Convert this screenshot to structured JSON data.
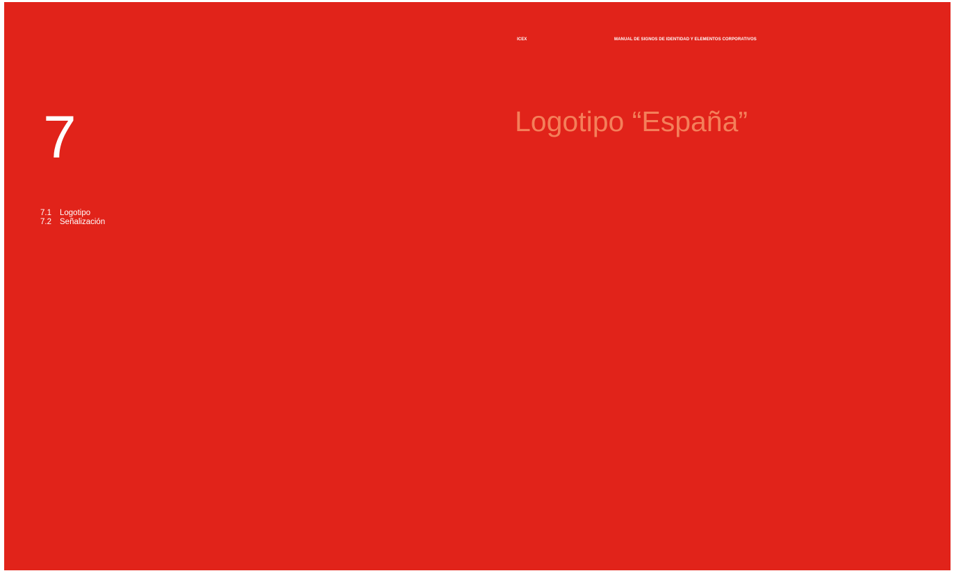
{
  "colors": {
    "page_background": "#e1231a",
    "text_primary": "#ffffff",
    "section_title": "#f47f5a"
  },
  "header": {
    "code": "ICEX",
    "title": "MANUAL DE SIGNOS DE IDENTIDAD Y ELEMENTOS CORPORATIVOS"
  },
  "chapter": {
    "number": "7",
    "toc": [
      {
        "num": "7.1",
        "label": "Logotipo"
      },
      {
        "num": "7.2",
        "label": "Señalización"
      }
    ]
  },
  "section": {
    "title": "Logotipo “España”"
  }
}
